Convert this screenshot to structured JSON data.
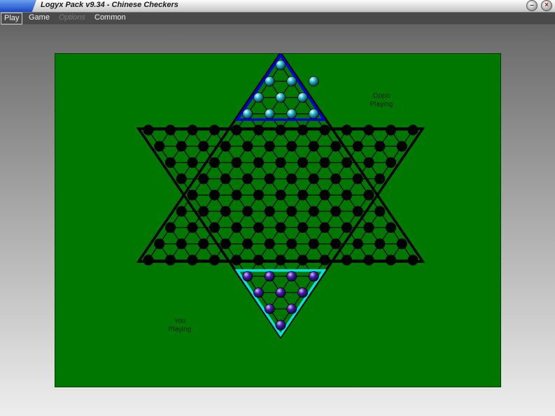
{
  "window": {
    "title": "Logyx Pack v9.34 - Chinese Checkers",
    "minimize_icon": "minimize-icon",
    "close_icon": "close-icon"
  },
  "menu": {
    "play": "Play",
    "game": "Game",
    "options": "Options",
    "common": "Common"
  },
  "status": {
    "opponent": {
      "name": "Oppo",
      "state": "Playing"
    },
    "player": {
      "name": "You",
      "state": "Playing"
    }
  },
  "colors": {
    "board": "#007800",
    "top_triangle": "#0000dd",
    "bottom_triangle": "#00e6e6",
    "opponent_pieces": "#22b4c8",
    "player_pieces": "#4a1ab0",
    "empty_hole": "#000000"
  },
  "board": {
    "opponent_pieces": [
      [
        0,
        0
      ],
      [
        1,
        0
      ],
      [
        1,
        1
      ],
      [
        2,
        0
      ],
      [
        2,
        1
      ],
      [
        2,
        2
      ],
      [
        3,
        0
      ],
      [
        3,
        1
      ],
      [
        3,
        2
      ],
      [
        3,
        3
      ]
    ],
    "player_pieces": [
      [
        0,
        0
      ],
      [
        0,
        1
      ],
      [
        0,
        2
      ],
      [
        0,
        3
      ],
      [
        1,
        0
      ],
      [
        1,
        1
      ],
      [
        1,
        2
      ],
      [
        2,
        0
      ],
      [
        2,
        1
      ],
      [
        3,
        0
      ]
    ],
    "stray_opponent_piece": true
  }
}
